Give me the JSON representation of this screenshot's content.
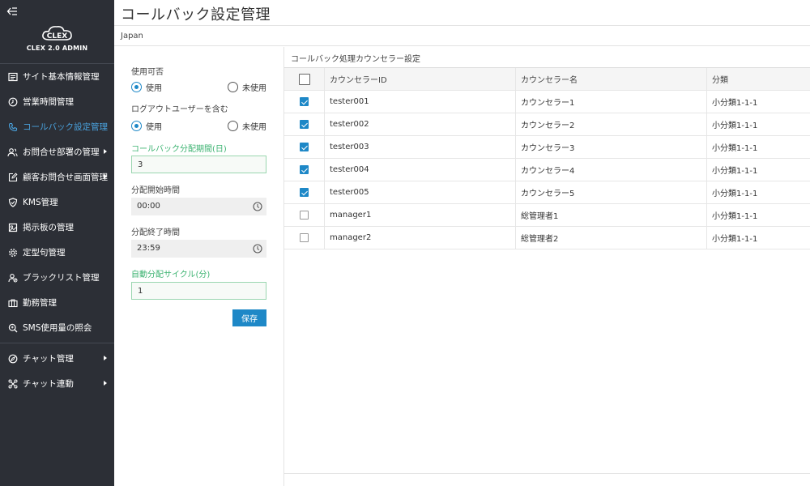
{
  "app": {
    "logo_text": "CLEX 2.0 ADMIN"
  },
  "sidebar": {
    "items": [
      {
        "label": "サイト基本情報管理",
        "icon": "site-info-icon",
        "active": false,
        "has_submenu": false
      },
      {
        "label": "営業時間管理",
        "icon": "clock-icon",
        "active": false,
        "has_submenu": false
      },
      {
        "label": "コールバック設定管理",
        "icon": "phone-icon",
        "active": true,
        "has_submenu": false
      },
      {
        "label": "お問合せ部署の管理",
        "icon": "users-icon",
        "active": false,
        "has_submenu": true
      },
      {
        "label": "顧客お問合せ画面管理",
        "icon": "edit-icon",
        "active": false,
        "has_submenu": true
      },
      {
        "label": "KMS管理",
        "icon": "shield-icon",
        "active": false,
        "has_submenu": false
      },
      {
        "label": "掲示板の管理",
        "icon": "board-icon",
        "active": false,
        "has_submenu": false
      },
      {
        "label": "定型句管理",
        "icon": "gear-icon",
        "active": false,
        "has_submenu": false
      },
      {
        "label": "ブラックリスト管理",
        "icon": "user-block-icon",
        "active": false,
        "has_submenu": false
      },
      {
        "label": "勤務管理",
        "icon": "briefcase-icon",
        "active": false,
        "has_submenu": false
      },
      {
        "label": "SMS使用量の照会",
        "icon": "search-icon",
        "active": false,
        "has_submenu": false
      }
    ],
    "bottom_items": [
      {
        "label": "チャット管理",
        "icon": "compass-icon",
        "has_submenu": true
      },
      {
        "label": "チャット連動",
        "icon": "link-icon",
        "has_submenu": true
      }
    ]
  },
  "header": {
    "title": "コールバック設定管理",
    "region": "Japan"
  },
  "settings": {
    "enabled_label": "使用可否",
    "enabled_options": [
      "使用",
      "未使用"
    ],
    "enabled_selected": "使用",
    "include_logout_label": "ログアウトユーザーを含む",
    "include_logout_options": [
      "使用",
      "未使用"
    ],
    "include_logout_selected": "使用",
    "period_label": "コールバック分配期間(日)",
    "period_value": "3",
    "start_label": "分配開始時間",
    "start_value": "00:00",
    "end_label": "分配終了時間",
    "end_value": "23:59",
    "cycle_label": "自動分配サイクル(分)",
    "cycle_value": "1",
    "save_label": "保存"
  },
  "table": {
    "title": "コールバック処理カウンセラー設定",
    "columns": [
      "カウンセラーID",
      "カウンセラー名",
      "分類"
    ],
    "header_checked": false,
    "rows": [
      {
        "checked": true,
        "id": "tester001",
        "name": "カウンセラー1",
        "category": "小分類1-1-1"
      },
      {
        "checked": true,
        "id": "tester002",
        "name": "カウンセラー2",
        "category": "小分類1-1-1"
      },
      {
        "checked": true,
        "id": "tester003",
        "name": "カウンセラー3",
        "category": "小分類1-1-1"
      },
      {
        "checked": true,
        "id": "tester004",
        "name": "カウンセラー4",
        "category": "小分類1-1-1"
      },
      {
        "checked": true,
        "id": "tester005",
        "name": "カウンセラー5",
        "category": "小分類1-1-1"
      },
      {
        "checked": false,
        "id": "manager1",
        "name": "総管理者1",
        "category": "小分類1-1-1"
      },
      {
        "checked": false,
        "id": "manager2",
        "name": "総管理者2",
        "category": "小分類1-1-1"
      }
    ]
  },
  "colors": {
    "sidebar_bg": "#2c2f36",
    "accent": "#1e88c7",
    "active_menu": "#4aa3df",
    "green_label": "#3cb371"
  }
}
